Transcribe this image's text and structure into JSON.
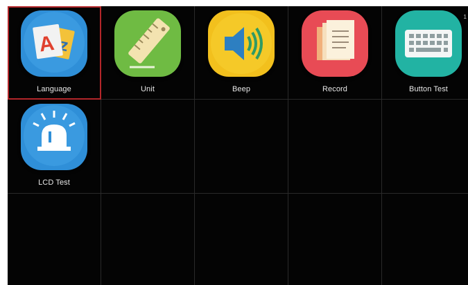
{
  "corner_indicator": "1",
  "apps": [
    {
      "label": "Language",
      "icon": "language-icon",
      "color": "#2f8fd8",
      "selected": true
    },
    {
      "label": "Unit",
      "icon": "ruler-icon",
      "color": "#6fbb43",
      "selected": false
    },
    {
      "label": "Beep",
      "icon": "speaker-icon",
      "color": "#f2c01d",
      "selected": false
    },
    {
      "label": "Record",
      "icon": "documents-icon",
      "color": "#e84b55",
      "selected": false
    },
    {
      "label": "Button Test",
      "icon": "keyboard-icon",
      "color": "#22b3a3",
      "selected": false
    },
    {
      "label": "LCD Test",
      "icon": "alarm-light-icon",
      "color": "#2f8fd8",
      "selected": false
    }
  ]
}
